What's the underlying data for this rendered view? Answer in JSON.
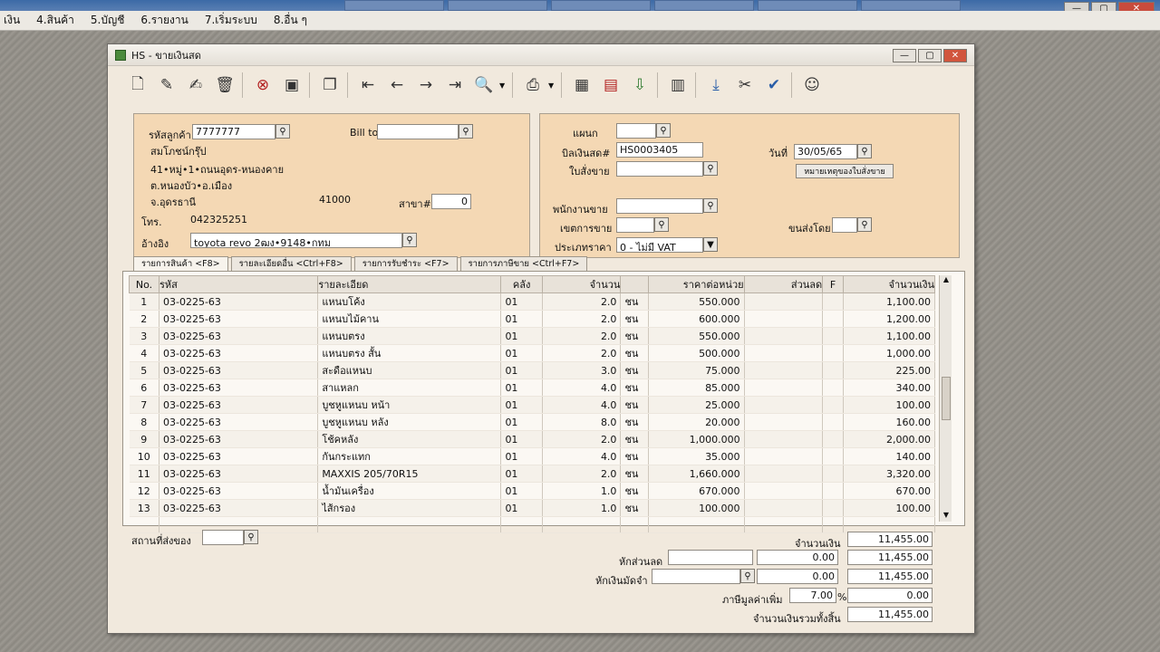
{
  "desktop": {
    "menu": [
      "เงิน",
      "4.สินค้า",
      "5.บัญชี",
      "6.รายงาน",
      "7.เริ่มระบบ",
      "8.อื่น ๆ"
    ]
  },
  "window": {
    "title": "HS - ขายเงินสด",
    "controls": {
      "minimize": "—",
      "maximize": "▢",
      "close": "✕"
    }
  },
  "toolbar": {
    "buttons": [
      {
        "name": "new-doc-icon",
        "glyph": "🗋"
      },
      {
        "name": "edit-doc-icon",
        "glyph": "✎"
      },
      {
        "name": "edit-alt-icon",
        "glyph": "✍"
      },
      {
        "name": "trash-icon",
        "glyph": "🗑"
      },
      {
        "name": "cancel-icon",
        "glyph": "⊗"
      },
      {
        "name": "save-icon",
        "glyph": "▣"
      },
      {
        "name": "copy-icon",
        "glyph": "❐"
      },
      {
        "name": "first-record-icon",
        "glyph": "⇤"
      },
      {
        "name": "prev-record-icon",
        "glyph": "←"
      },
      {
        "name": "next-record-icon",
        "glyph": "→"
      },
      {
        "name": "last-record-icon",
        "glyph": "⇥"
      },
      {
        "name": "search-doc-icon",
        "glyph": "🔍"
      },
      {
        "name": "print-icon",
        "glyph": "⎙"
      },
      {
        "name": "calc-icon",
        "glyph": "▦"
      },
      {
        "name": "doc-red-icon",
        "glyph": "▤"
      },
      {
        "name": "download-icon",
        "glyph": "⇩"
      },
      {
        "name": "grid-doc-icon",
        "glyph": "▥"
      },
      {
        "name": "import-icon",
        "glyph": "⤓"
      },
      {
        "name": "tools-icon",
        "glyph": "✂"
      },
      {
        "name": "ok-icon",
        "glyph": "✔"
      },
      {
        "name": "users-icon",
        "glyph": "☺"
      }
    ]
  },
  "customer": {
    "code_label": "รหัสลูกค้า",
    "code": "7777777",
    "name": "สมโภชน์กรุ๊ป",
    "address1": "41•หมู่•1•ถนนอุดร-หนองคาย",
    "address2": "ต.หนองบัว•อ.เมือง",
    "address3": "จ.อุดรธานี",
    "postcode": "41000",
    "branch_label": "สาขา#",
    "branch": "0",
    "bill_to_label": "Bill to",
    "bill_to": "",
    "phone_label": "โทร.",
    "phone": "042325251",
    "ref_label": "อ้างอิง",
    "ref": "toyota revo 2ฒง•9148•กทม"
  },
  "doc": {
    "dept_label": "แผนก",
    "dept": "",
    "invoice_label": "บิลเงินสด#",
    "invoice": "HS0003405",
    "order_label": "ใบสั่งขาย",
    "order": "",
    "date_label": "วันที่",
    "date": "30/05/65",
    "note_button": "หมายเหตุของใบสั่งขาย",
    "salesman_label": "พนักงานขาย",
    "salesman": "",
    "area_label": "เขตการขาย",
    "area": "",
    "ship_label": "ขนส่งโดย",
    "ship": "",
    "price_type_label": "ประเภทราคา",
    "price_type": "0 - ไม่มี VAT"
  },
  "tabs": [
    "รายการสินค้า <F8>",
    "รายละเอียดอื่น <Ctrl+F8>",
    "รายการรับชำระ <F7>",
    "รายการภาษีขาย <Ctrl+F7>"
  ],
  "grid": {
    "columns": [
      "No.",
      "รหัส",
      "รายละเอียด",
      "คลัง",
      "จำนวน",
      "",
      "ราคาต่อหน่วย",
      "ส่วนลด",
      "F",
      "จำนวนเงิน"
    ],
    "rows": [
      {
        "no": "1",
        "code": "03-0225-63",
        "desc": "แหนบโค้ง",
        "wh": "01",
        "qty": "2.0",
        "unit": "ชน",
        "price": "550.000",
        "disc": "",
        "f": "",
        "amount": "1,100.00"
      },
      {
        "no": "2",
        "code": "03-0225-63",
        "desc": "แหนบไม้คาน",
        "wh": "01",
        "qty": "2.0",
        "unit": "ชน",
        "price": "600.000",
        "disc": "",
        "f": "",
        "amount": "1,200.00"
      },
      {
        "no": "3",
        "code": "03-0225-63",
        "desc": "แหนบตรง",
        "wh": "01",
        "qty": "2.0",
        "unit": "ชน",
        "price": "550.000",
        "disc": "",
        "f": "",
        "amount": "1,100.00"
      },
      {
        "no": "4",
        "code": "03-0225-63",
        "desc": "แหนบตรง สั้น",
        "wh": "01",
        "qty": "2.0",
        "unit": "ชน",
        "price": "500.000",
        "disc": "",
        "f": "",
        "amount": "1,000.00"
      },
      {
        "no": "5",
        "code": "03-0225-63",
        "desc": "สะดือแหนบ",
        "wh": "01",
        "qty": "3.0",
        "unit": "ชน",
        "price": "75.000",
        "disc": "",
        "f": "",
        "amount": "225.00"
      },
      {
        "no": "6",
        "code": "03-0225-63",
        "desc": "สาแหลก",
        "wh": "01",
        "qty": "4.0",
        "unit": "ชน",
        "price": "85.000",
        "disc": "",
        "f": "",
        "amount": "340.00"
      },
      {
        "no": "7",
        "code": "03-0225-63",
        "desc": "บูชหูแหนบ หน้า",
        "wh": "01",
        "qty": "4.0",
        "unit": "ชน",
        "price": "25.000",
        "disc": "",
        "f": "",
        "amount": "100.00"
      },
      {
        "no": "8",
        "code": "03-0225-63",
        "desc": "บูชหูแหนบ หลัง",
        "wh": "01",
        "qty": "8.0",
        "unit": "ชน",
        "price": "20.000",
        "disc": "",
        "f": "",
        "amount": "160.00"
      },
      {
        "no": "9",
        "code": "03-0225-63",
        "desc": "โช้คหลัง",
        "wh": "01",
        "qty": "2.0",
        "unit": "ชน",
        "price": "1,000.000",
        "disc": "",
        "f": "",
        "amount": "2,000.00"
      },
      {
        "no": "10",
        "code": "03-0225-63",
        "desc": "กันกระแทก",
        "wh": "01",
        "qty": "4.0",
        "unit": "ชน",
        "price": "35.000",
        "disc": "",
        "f": "",
        "amount": "140.00"
      },
      {
        "no": "11",
        "code": "03-0225-63",
        "desc": "MAXXIS 205/70R15",
        "wh": "01",
        "qty": "2.0",
        "unit": "ชน",
        "price": "1,660.000",
        "disc": "",
        "f": "",
        "amount": "3,320.00"
      },
      {
        "no": "12",
        "code": "03-0225-63",
        "desc": "น้ำมันเครื่อง",
        "wh": "01",
        "qty": "1.0",
        "unit": "ชน",
        "price": "670.000",
        "disc": "",
        "f": "",
        "amount": "670.00"
      },
      {
        "no": "13",
        "code": "03-0225-63",
        "desc": "ไส้กรอง",
        "wh": "01",
        "qty": "1.0",
        "unit": "ชน",
        "price": "100.000",
        "disc": "",
        "f": "",
        "amount": "100.00"
      }
    ]
  },
  "footer": {
    "ship_place_label": "สถานที่ส่งของ",
    "ship_place": "",
    "amount_label": "จำนวนเงิน",
    "amount": "11,455.00",
    "discount_label": "หักส่วนลด",
    "discount_text": "",
    "discount_value": "0.00",
    "after_discount": "11,455.00",
    "deposit_label": "หักเงินมัดจำ",
    "deposit_text": "",
    "deposit_value": "0.00",
    "after_deposit": "11,455.00",
    "vat_label": "ภาษีมูลค่าเพิ่ม",
    "vat_rate": "7.00",
    "vat_pct": "%",
    "vat_amount": "0.00",
    "grand_total_label": "จำนวนเงินรวมทั้งสิ้น",
    "grand_total": "11,455.00"
  }
}
